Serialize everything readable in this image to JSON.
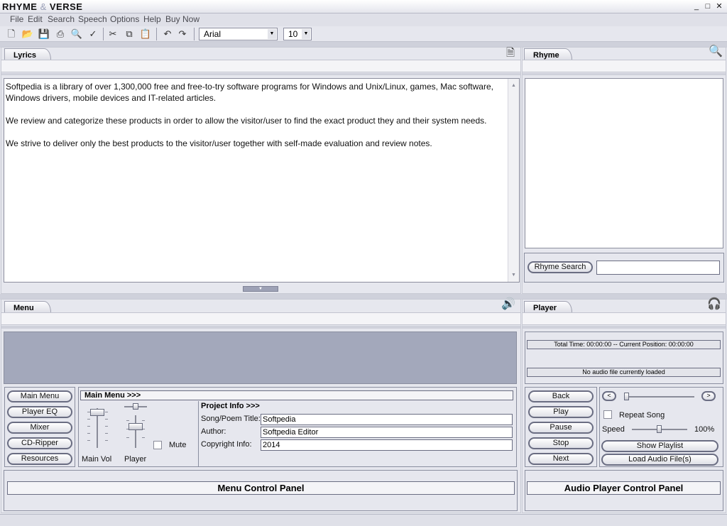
{
  "window": {
    "title_a": "RHYME",
    "title_amp": "&",
    "title_b": "VERSE",
    "minimize": "_",
    "maximize": "□",
    "close": "✕"
  },
  "menubar": [
    "File",
    "Edit",
    "Search",
    "Speech",
    "Options",
    "Help",
    "Buy Now"
  ],
  "toolbar": {
    "font": "Arial",
    "font_size": "10",
    "icons": [
      "new-icon",
      "open-icon",
      "save-icon",
      "print-icon",
      "print-preview-icon",
      "spellcheck-icon",
      "cut-icon",
      "copy-icon",
      "paste-icon",
      "undo-icon",
      "redo-icon"
    ]
  },
  "lyrics": {
    "tab": "Lyrics",
    "paragraphs": [
      "Softpedia is a library of over 1,300,000 free and free-to-try software programs for Windows and Unix/Linux, games, Mac software, Windows drivers, mobile devices and IT-related articles.",
      "We review and categorize these products in order to allow the visitor/user to find the exact product they and their system needs.",
      "We strive to deliver only the best products to the visitor/user together with self-made evaluation and review notes."
    ]
  },
  "rhyme": {
    "tab": "Rhyme",
    "search_button": "Rhyme Search",
    "search_value": ""
  },
  "menu": {
    "tab": "Menu",
    "buttons": [
      "Main Menu",
      "Player EQ",
      "Mixer",
      "CD-Ripper",
      "Resources"
    ],
    "main_menu_header": "Main Menu >>>",
    "main_vol_label": "Main Vol",
    "player_label": "Player",
    "mute_label": "Mute",
    "project_info_header": "Project Info >>>",
    "song_title_label": "Song/Poem Title:",
    "song_title_value": "Softpedia",
    "author_label": "Author:",
    "author_value": "Softpedia Editor",
    "copyright_label": "Copyright Info:",
    "copyright_value": "2014",
    "control_panel_title": "Menu Control Panel"
  },
  "player": {
    "tab": "Player",
    "time_readout": "Total Time: 00:00:00 -- Current Position: 00:00:00",
    "status": "No audio file currently loaded",
    "buttons": [
      "Back",
      "Play",
      "Pause",
      "Stop",
      "Next"
    ],
    "repeat_label": "Repeat Song",
    "speed_label": "Speed",
    "speed_value": "100%",
    "speed_level": 0.5,
    "show_playlist": "Show Playlist",
    "load_audio": "Load Audio File(s)",
    "prev_glyph": "<",
    "next_glyph": ">",
    "control_panel_title": "Audio Player Control Panel"
  },
  "colors": {
    "panel_bg": "#e6e7ee",
    "display_area": "#a3a8bb",
    "border_dark": "#6a6d82"
  }
}
